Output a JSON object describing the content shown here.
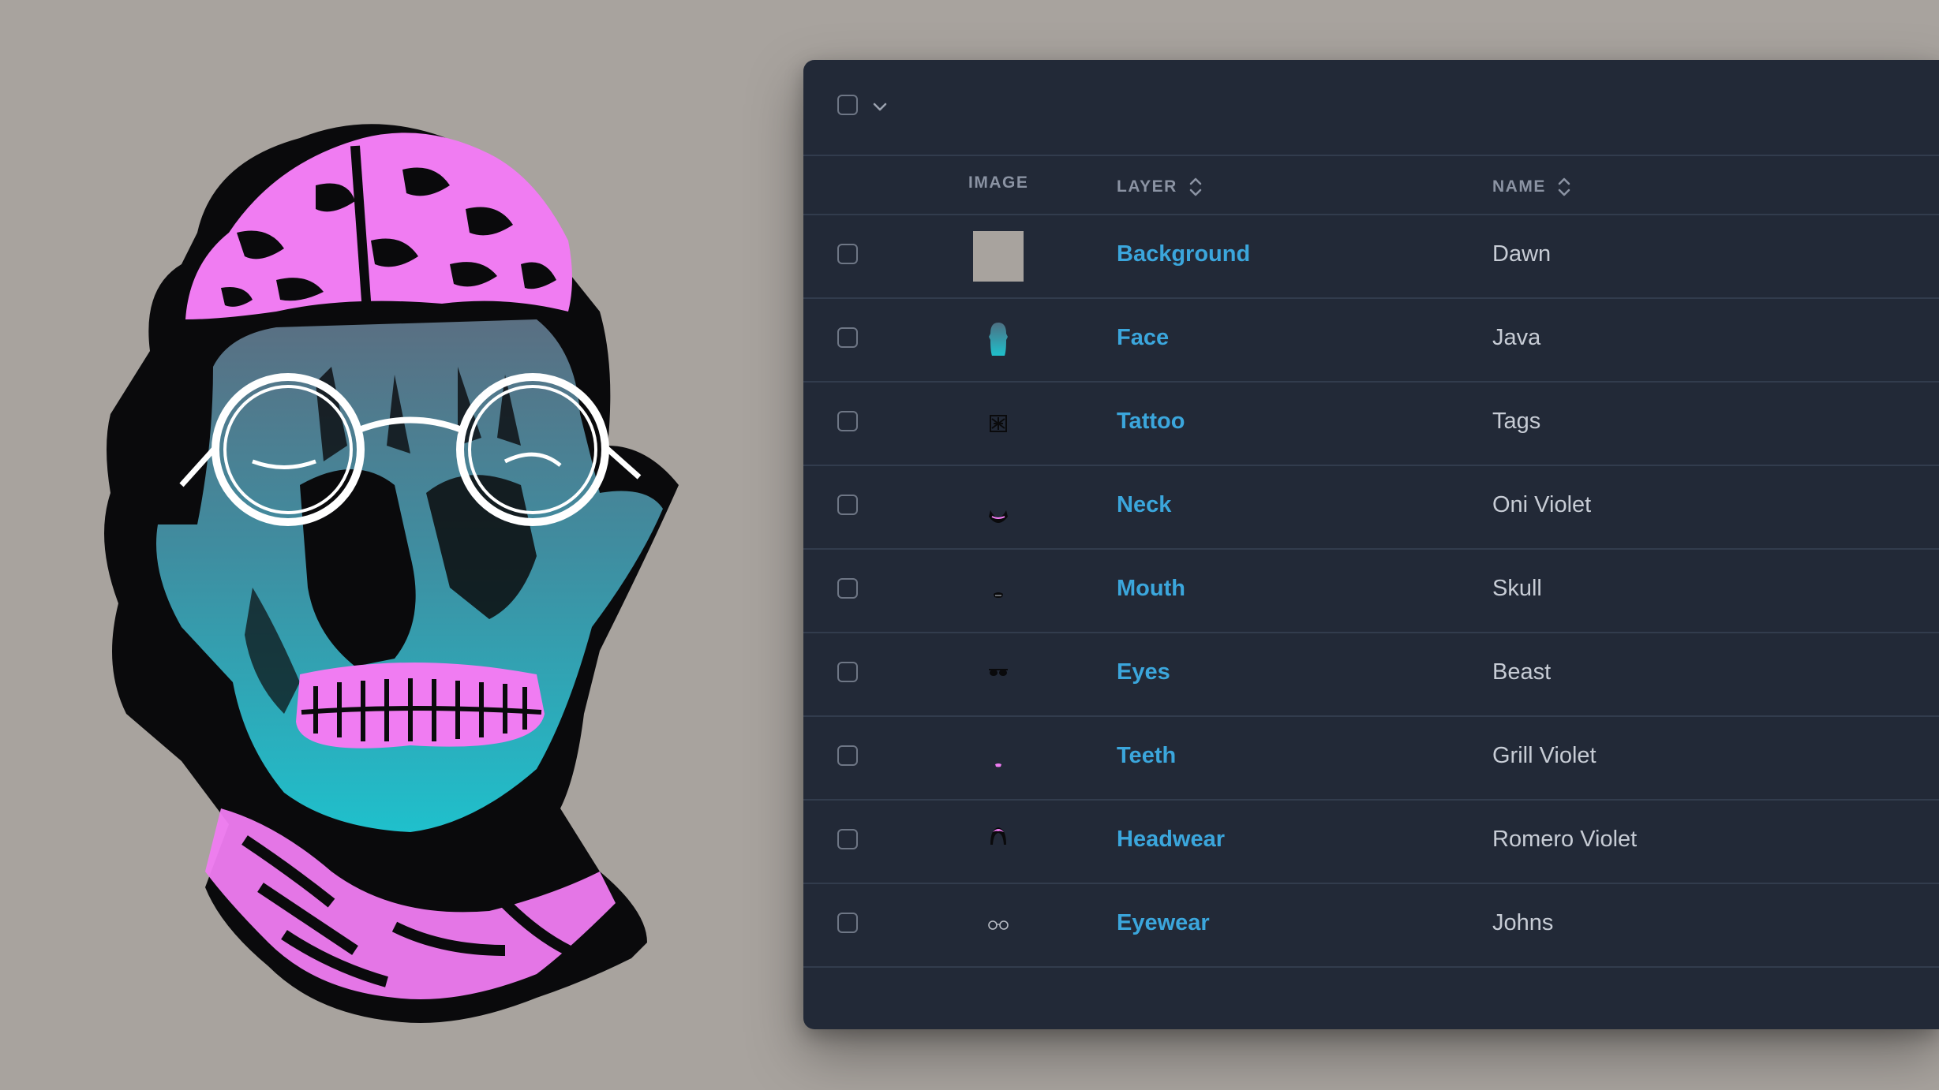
{
  "colors": {
    "background": "#a8a39e",
    "panel": "#222937",
    "divider": "#323c4d",
    "link": "#3ba6dc",
    "text": "#c7ccd5",
    "header_text": "#8b93a3",
    "art_pink": "#f07cf2",
    "art_teal": "#22b9c8",
    "art_slate": "#4d6f82"
  },
  "toolbar": {
    "select_all_icon": "checkbox-empty",
    "dropdown_icon": "chevron-down-icon"
  },
  "table": {
    "headers": {
      "image": "IMAGE",
      "layer": "LAYER",
      "name": "NAME"
    },
    "rows": [
      {
        "layer": "Background",
        "name": "Dawn",
        "thumb": "background-swatch"
      },
      {
        "layer": "Face",
        "name": "Java",
        "thumb": "face-thumb"
      },
      {
        "layer": "Tattoo",
        "name": "Tags",
        "thumb": "tattoo-thumb"
      },
      {
        "layer": "Neck",
        "name": "Oni Violet",
        "thumb": "neck-thumb"
      },
      {
        "layer": "Mouth",
        "name": "Skull",
        "thumb": "mouth-thumb"
      },
      {
        "layer": "Eyes",
        "name": "Beast",
        "thumb": "eyes-thumb"
      },
      {
        "layer": "Teeth",
        "name": "Grill Violet",
        "thumb": "teeth-thumb"
      },
      {
        "layer": "Headwear",
        "name": "Romero Violet",
        "thumb": "headwear-thumb"
      },
      {
        "layer": "Eyewear",
        "name": "Johns",
        "thumb": "eyewear-thumb"
      }
    ]
  }
}
